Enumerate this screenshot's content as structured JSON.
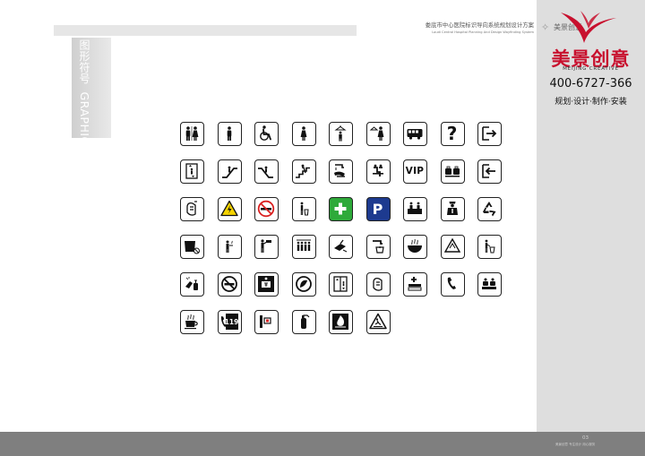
{
  "header": {
    "title_cn": "娄底市中心医院标识导向系统规划设计方案",
    "title_en": "Loudi Central Hospital Planning And Design Wayfinding System"
  },
  "mini_logo": {
    "text": "美景创意"
  },
  "side_label": {
    "cn": "图形符号",
    "en": "GRAPHIC SYMBOL"
  },
  "brand": {
    "name": "美景创意",
    "name_en": "MEIJING CREATIVE",
    "phone": "400-6727-366",
    "services": "规划·设计·制作·安装"
  },
  "footer": {
    "page_number": "03",
    "note": "美景创意 专注设计 用心服务"
  },
  "colors": {
    "brand_red": "#c8102e",
    "panel_gray": "#dedede",
    "footer_gray": "#7f7f7f",
    "sign_green": "#2eaa3a",
    "sign_blue": "#1d3a8f",
    "warning_yellow": "#f5d300",
    "prohibit_red": "#d92020"
  },
  "icons": [
    {
      "name": "restrooms-icon"
    },
    {
      "name": "mens-room-icon"
    },
    {
      "name": "accessible-icon"
    },
    {
      "name": "womens-room-icon"
    },
    {
      "name": "mens-changing-icon"
    },
    {
      "name": "womens-changing-icon"
    },
    {
      "name": "bus-icon"
    },
    {
      "name": "information-icon",
      "text": "?"
    },
    {
      "name": "exit-icon"
    },
    {
      "name": "elevator-icon"
    },
    {
      "name": "escalator-up-icon"
    },
    {
      "name": "escalator-down-icon"
    },
    {
      "name": "stairs-icon"
    },
    {
      "name": "hand-wash-icon"
    },
    {
      "name": "waiting-area-icon"
    },
    {
      "name": "vip-icon",
      "text": "VIP"
    },
    {
      "name": "luggage-icon"
    },
    {
      "name": "entrance-icon"
    },
    {
      "name": "hand-hygiene-icon"
    },
    {
      "name": "high-voltage-warning-icon"
    },
    {
      "name": "no-smoking-icon"
    },
    {
      "name": "litter-bin-icon"
    },
    {
      "name": "first-aid-icon"
    },
    {
      "name": "parking-icon",
      "text": "P"
    },
    {
      "name": "reception-desk-icon"
    },
    {
      "name": "police-icon"
    },
    {
      "name": "recycling-icon"
    },
    {
      "name": "no-pets-icon"
    },
    {
      "name": "smoking-area-icon"
    },
    {
      "name": "lecture-icon"
    },
    {
      "name": "queue-icon"
    },
    {
      "name": "cleaning-icon"
    },
    {
      "name": "drinking-water-icon"
    },
    {
      "name": "canteen-icon"
    },
    {
      "name": "recycle-triangle-icon"
    },
    {
      "name": "trash-can-icon"
    },
    {
      "name": "hand-disinfection-icon"
    },
    {
      "name": "no-smoking-round-icon"
    },
    {
      "name": "cashier-icon"
    },
    {
      "name": "no-entry-icon"
    },
    {
      "name": "lift-interior-icon"
    },
    {
      "name": "hand-sanitizer-icon"
    },
    {
      "name": "pharmacy-icon"
    },
    {
      "name": "telephone-icon"
    },
    {
      "name": "waiting-room-icon"
    },
    {
      "name": "coffee-icon"
    },
    {
      "name": "fire-alarm-119-icon",
      "text": "119"
    },
    {
      "name": "fire-hose-icon"
    },
    {
      "name": "fire-extinguisher-icon"
    },
    {
      "name": "fire-hazard-icon"
    },
    {
      "name": "slippery-warning-icon"
    }
  ]
}
